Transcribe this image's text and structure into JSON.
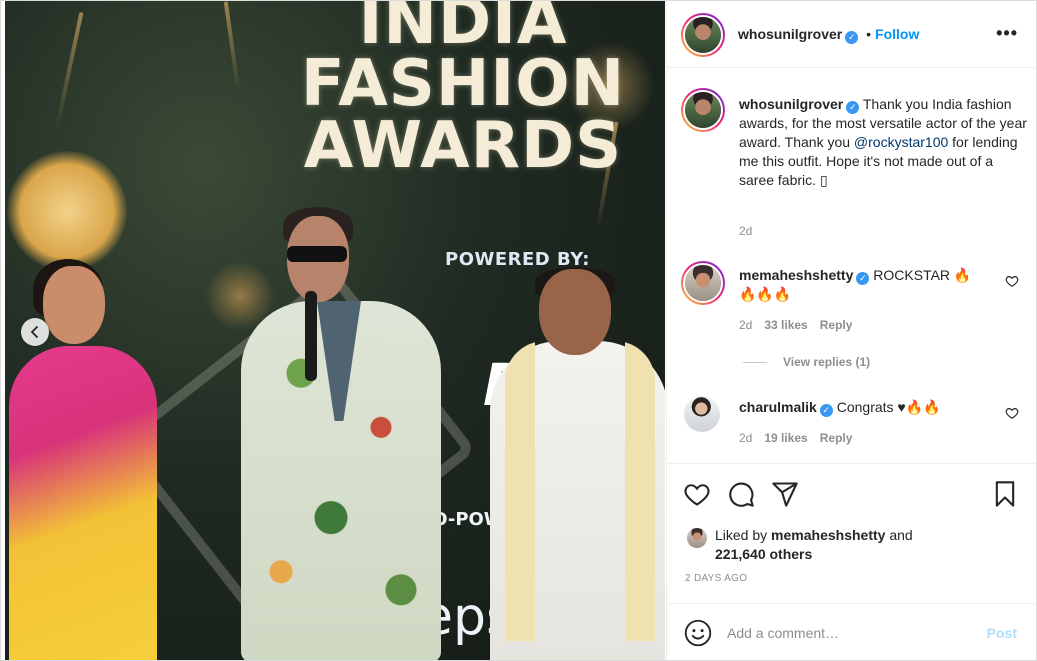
{
  "photo": {
    "title_line1": "INDIA",
    "title_line2": "FASHION",
    "title_line3": "AWARDS",
    "powered_by": "POWERED BY:",
    "co_powered": "CO-POW",
    "sponsor_fragment": "epsi",
    "sponsor_letter": "D"
  },
  "header": {
    "username": "whosunilgrover",
    "separator": "•",
    "follow_label": "Follow",
    "more_label": "•••"
  },
  "caption": {
    "username": "whosunilgrover",
    "text_before": "Thank you India fashion awards, for the most versatile actor of the year award. Thank you ",
    "mention": "@rockystar100",
    "text_after": " for lending me this outfit. Hope it's not made out of a saree fabric. ",
    "trailing_glyph": "▯",
    "age": "2d"
  },
  "comments": [
    {
      "username": "memaheshshetty",
      "text": "ROCKSTAR 🔥",
      "text_line2": "🔥🔥🔥",
      "age": "2d",
      "likes": "33 likes",
      "reply_label": "Reply",
      "view_replies": "View replies (1)"
    },
    {
      "username": "charulmalik",
      "text": "Congrats ♥🔥🔥",
      "age": "2d",
      "likes": "19 likes",
      "reply_label": "Reply"
    }
  ],
  "likes": {
    "prefix": "Liked by",
    "user": "memaheshshetty",
    "and": "and",
    "others": "221,640 others"
  },
  "timestamp": "2 DAYS AGO",
  "add_comment": {
    "placeholder": "Add a comment…",
    "post_label": "Post"
  },
  "colors": {
    "accent_blue": "#0095f6",
    "post_disabled": "#b2dffc",
    "verified_blue": "#3897f0",
    "muted_text": "#8e8e8e"
  },
  "icons": [
    "chevron-left-icon",
    "verified-badge-icon",
    "more-icon",
    "heart-icon",
    "comment-icon",
    "share-icon",
    "bookmark-icon",
    "emoji-icon"
  ]
}
